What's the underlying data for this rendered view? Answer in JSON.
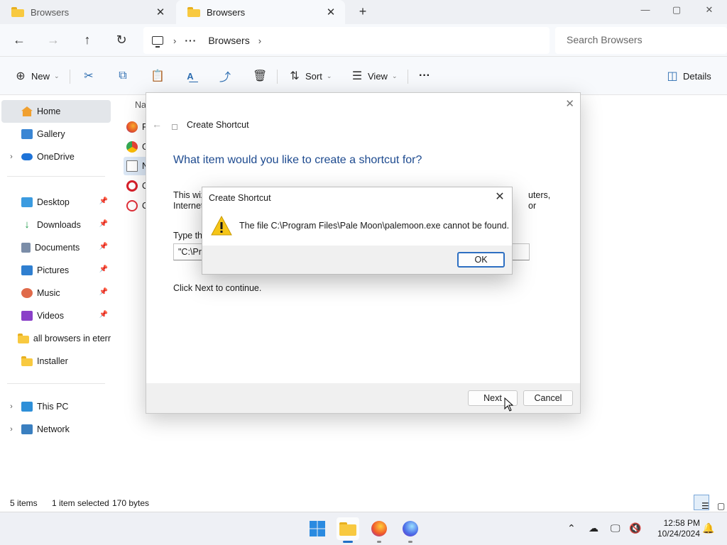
{
  "tabs": [
    {
      "label": "Browsers",
      "state": "inactive"
    },
    {
      "label": "Browsers",
      "state": "active"
    }
  ],
  "window_controls": {
    "minimize": "—",
    "maximize": "▢",
    "close": "✕"
  },
  "address_bar": {
    "more": "···",
    "current_folder": "Browsers",
    "search_placeholder": "Search Browsers"
  },
  "command_bar": {
    "new_label": "New",
    "sort_label": "Sort",
    "view_label": "View",
    "more_label": "···",
    "details_label": "Details"
  },
  "sidebar": {
    "home": "Home",
    "gallery": "Gallery",
    "onedrive": "OneDrive",
    "quick_access": [
      {
        "label": "Desktop",
        "icon": "desktop-icon",
        "pinned": true
      },
      {
        "label": "Downloads",
        "icon": "downloads-icon",
        "pinned": true
      },
      {
        "label": "Documents",
        "icon": "documents-icon",
        "pinned": true
      },
      {
        "label": "Pictures",
        "icon": "pictures-icon",
        "pinned": true
      },
      {
        "label": "Music",
        "icon": "music-icon",
        "pinned": true
      },
      {
        "label": "Videos",
        "icon": "videos-icon",
        "pinned": true
      },
      {
        "label": "all browsers in eterr",
        "icon": "folder-icon",
        "pinned": false
      },
      {
        "label": "Installer",
        "icon": "folder-icon",
        "pinned": false
      }
    ],
    "this_pc": "This PC",
    "network": "Network"
  },
  "file_list": {
    "column_name": "Na",
    "rows": [
      {
        "label": "Fi",
        "icon": "firefox-icon",
        "selected": false
      },
      {
        "label": "G",
        "icon": "chrome-icon",
        "selected": false
      },
      {
        "label": "N",
        "icon": "shortcut-file-icon",
        "selected": true
      },
      {
        "label": "O",
        "icon": "opera-icon",
        "selected": false
      },
      {
        "label": "O",
        "icon": "opera-gx-icon",
        "selected": false
      }
    ]
  },
  "status_bar": {
    "items_count": "5 items",
    "selection": "1 item selected",
    "size": "170 bytes"
  },
  "wizard": {
    "title": "Create Shortcut",
    "heading": "What item would you like to create a shortcut for?",
    "description_left_1": "This wiz",
    "description_left_2": "Internet",
    "description_right": "uters, or",
    "location_label": "Type th",
    "location_value": "\"C:\\Pro",
    "continue_text": "Click Next to continue.",
    "next_label": "Next",
    "cancel_label": "Cancel"
  },
  "error_dialog": {
    "title": "Create Shortcut",
    "message": "The file C:\\Program Files\\Pale Moon\\palemoon.exe cannot be found.",
    "ok_label": "OK"
  },
  "taskbar": {
    "time": "12:58 PM",
    "date": "10/24/2024"
  },
  "colors": {
    "accent": "#1f6fc7",
    "heading_blue": "#1d4a8f",
    "warning_yellow": "#f5c518",
    "folder_yellow": "#f8c940"
  }
}
